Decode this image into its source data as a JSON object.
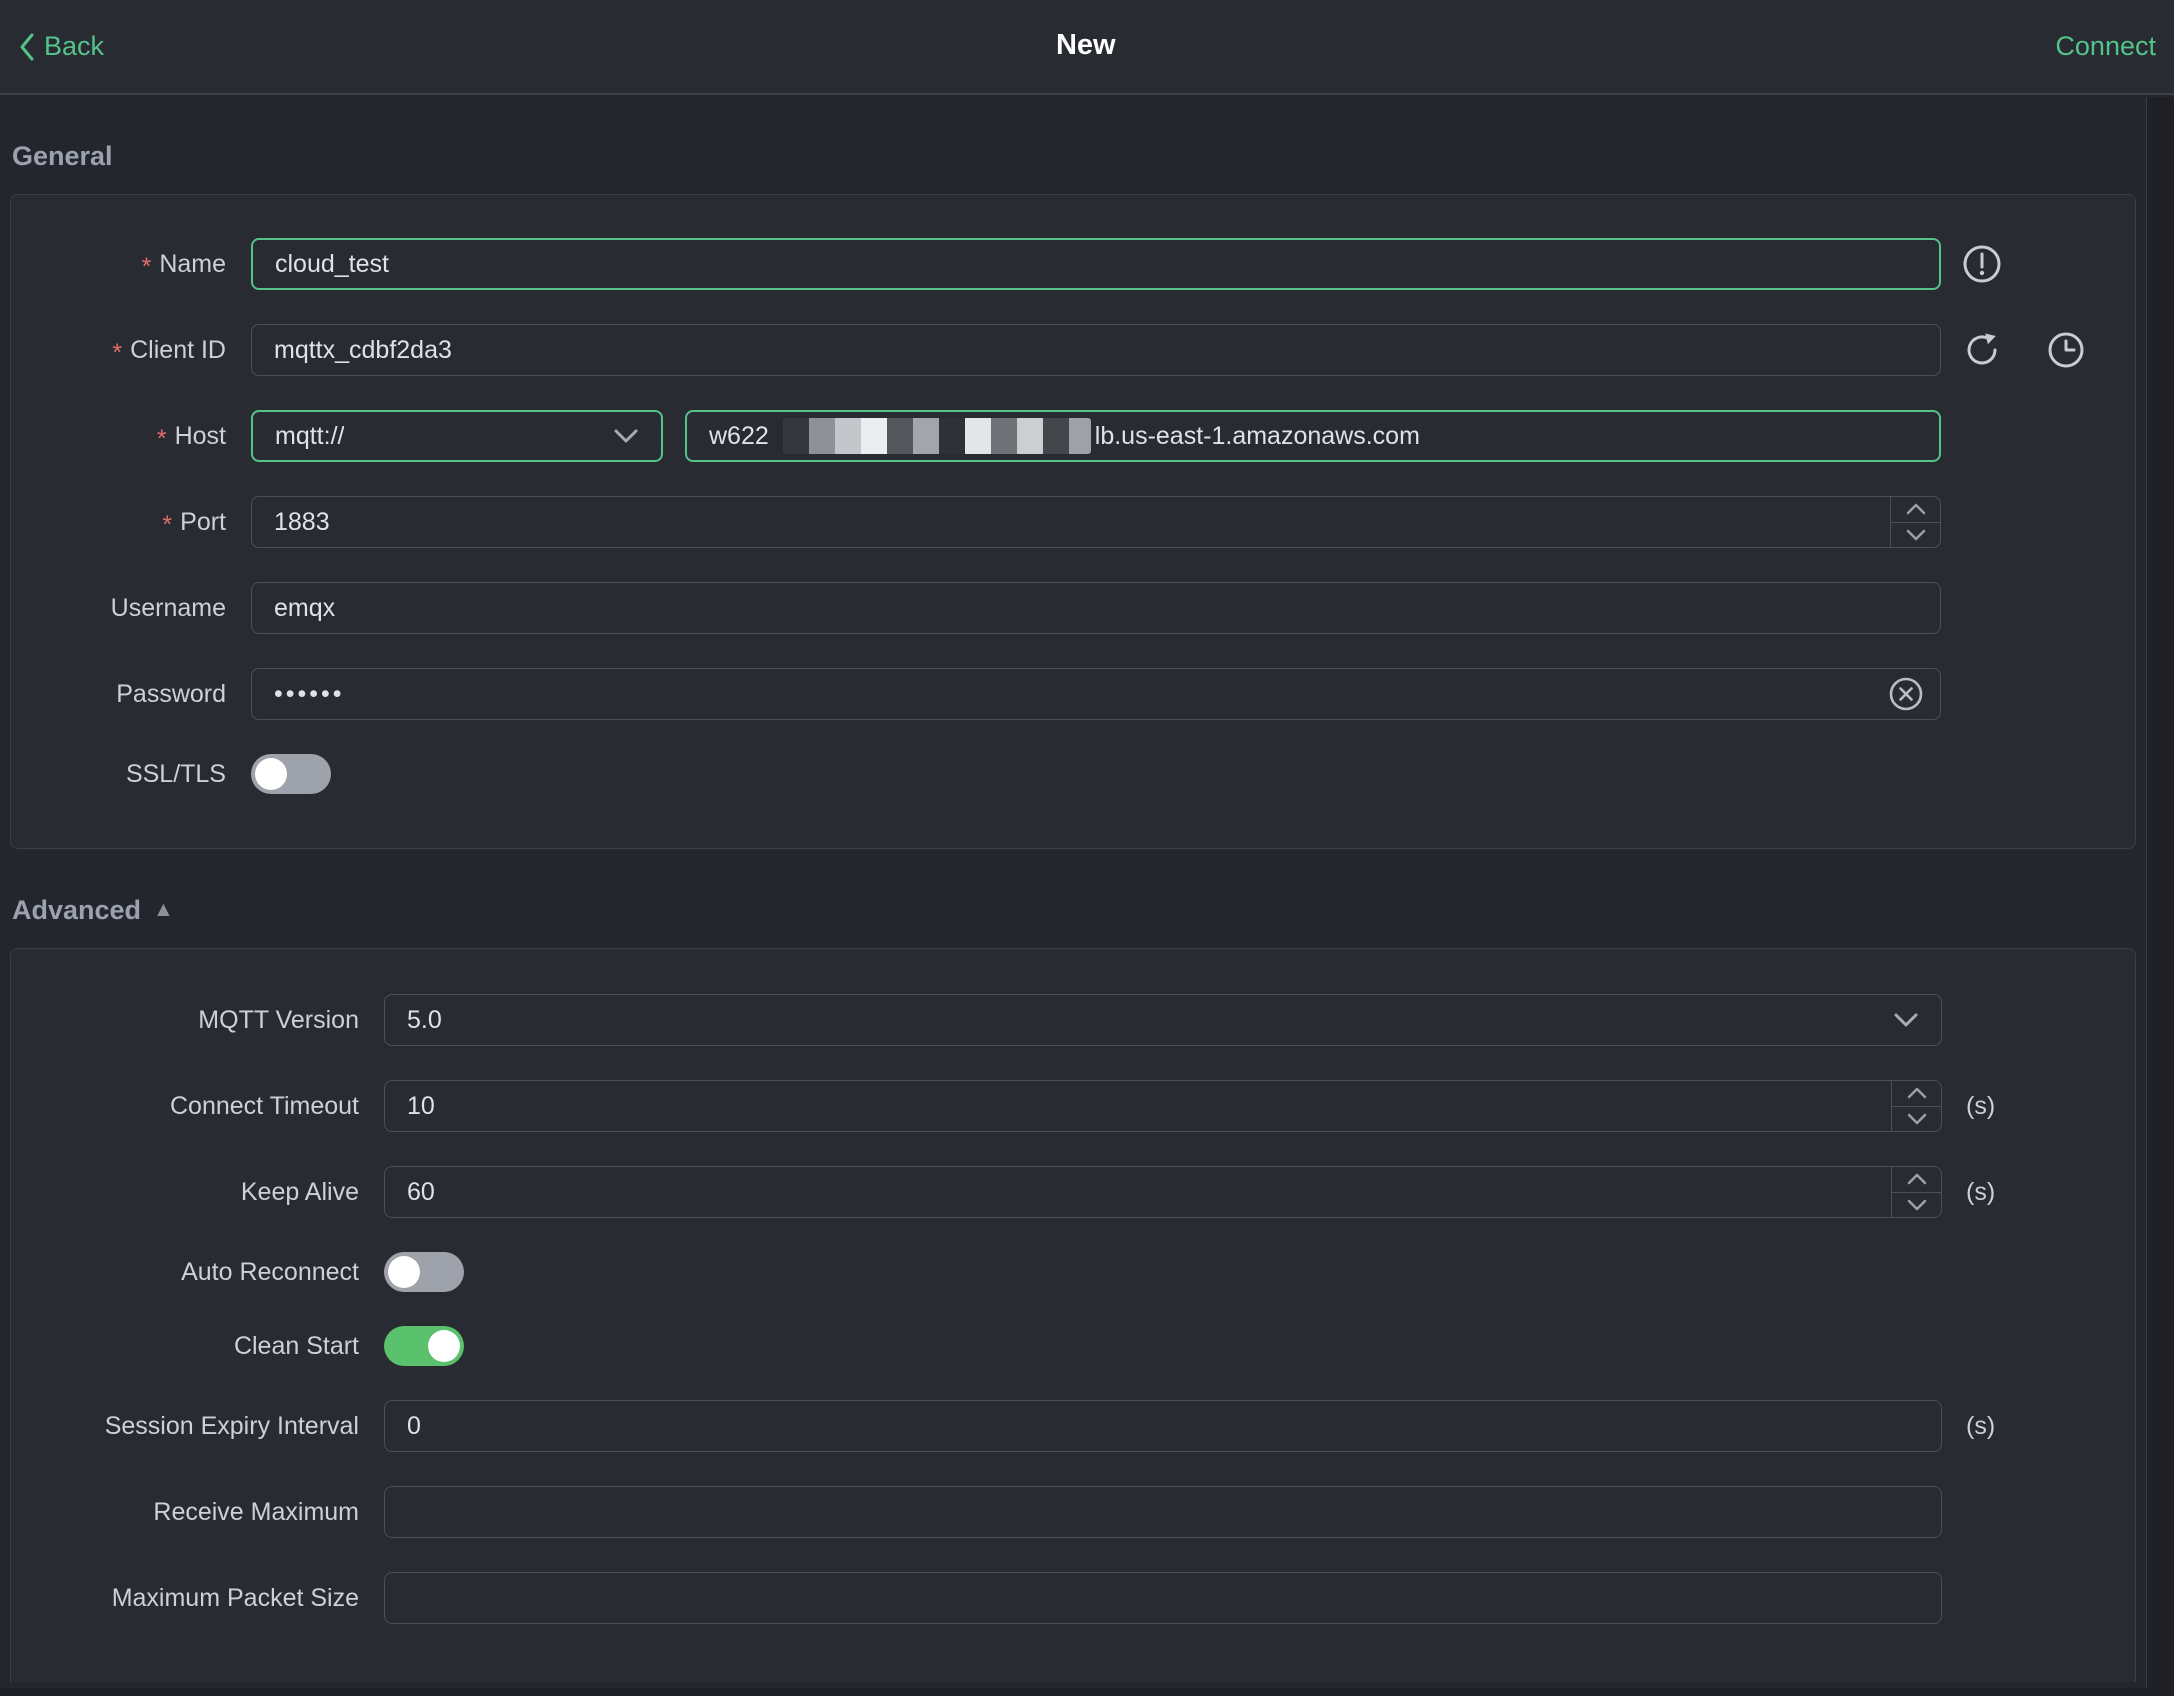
{
  "topbar": {
    "back_label": "Back",
    "title": "New",
    "connect_label": "Connect"
  },
  "misc": {
    "required_marker": "*",
    "collapse_arrow": "▲"
  },
  "general": {
    "heading": "General",
    "fields": {
      "name": {
        "label": "Name",
        "required": true,
        "value": "cloud_test"
      },
      "client_id": {
        "label": "Client ID",
        "required": true,
        "value": "mqttx_cdbf2da3"
      },
      "host": {
        "label": "Host",
        "required": true,
        "protocol": "mqtt://",
        "value_prefix": "w622",
        "redacted_middle": true,
        "value_suffix": "lb.us-east-1.amazonaws.com"
      },
      "port": {
        "label": "Port",
        "required": true,
        "value": "1883"
      },
      "username": {
        "label": "Username",
        "required": false,
        "value": "emqx"
      },
      "password": {
        "label": "Password",
        "required": false,
        "value_masked": "••••••"
      },
      "ssl": {
        "label": "SSL/TLS",
        "enabled": false
      }
    },
    "icons": [
      "warning-icon",
      "refresh-icon",
      "history-clock-icon",
      "clear-circle-icon"
    ]
  },
  "advanced": {
    "heading": "Advanced",
    "fields": {
      "mqtt_version": {
        "label": "MQTT Version",
        "value": "5.0"
      },
      "connect_timeout": {
        "label": "Connect Timeout",
        "value": "10",
        "unit": "(s)"
      },
      "keep_alive": {
        "label": "Keep Alive",
        "value": "60",
        "unit": "(s)"
      },
      "auto_reconnect": {
        "label": "Auto Reconnect",
        "enabled": false
      },
      "clean_start": {
        "label": "Clean Start",
        "enabled": true
      },
      "session_expiry": {
        "label": "Session Expiry Interval",
        "value": "0",
        "unit": "(s)"
      },
      "receive_maximum": {
        "label": "Receive Maximum",
        "value": ""
      },
      "maximum_packet_size": {
        "label": "Maximum Packet Size",
        "value": ""
      }
    }
  },
  "colors": {
    "accent_green": "#54c38a",
    "toggle_on_green": "#5ac16c",
    "required_red": "#e06c6c",
    "card_bg": "#292b33",
    "page_bg": "#24262d"
  }
}
